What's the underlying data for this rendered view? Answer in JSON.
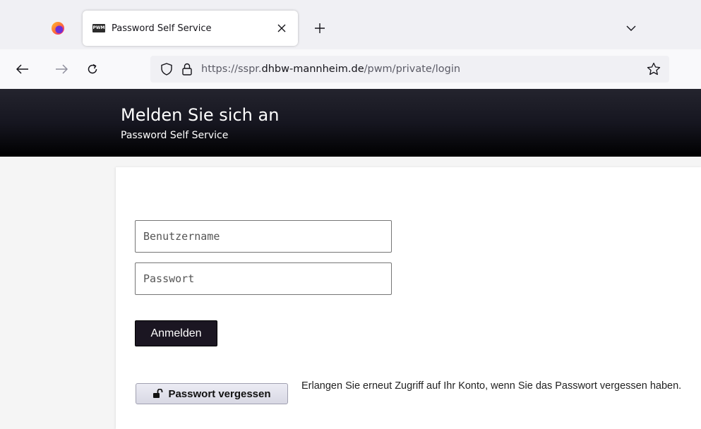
{
  "browser": {
    "tab": {
      "favicon_text": "PWM",
      "title": "Password Self Service",
      "close_glyph": "✕"
    },
    "new_tab_glyph": "+",
    "url": {
      "prefix": "https://sspr.",
      "host": "dhbw-mannheim.de",
      "path": "/pwm/private/login"
    },
    "icons": [
      "firefox-icon",
      "back-arrow-icon",
      "forward-arrow-icon",
      "reload-icon",
      "shield-icon",
      "lock-icon",
      "bookmark-star-icon",
      "chevron-down-icon"
    ]
  },
  "header": {
    "title": "Melden Sie sich an",
    "subtitle": "Password Self Service",
    "background": "#000000"
  },
  "form": {
    "username_placeholder": "Benutzername",
    "password_placeholder": "Passwort",
    "login_label": "Anmelden",
    "login_color": "#1b1622"
  },
  "forgot": {
    "button_label": "Passwort vergessen",
    "description": "Erlangen Sie erneut Zugriff auf Ihr Konto, wenn Sie das Passwort vergessen haben."
  }
}
